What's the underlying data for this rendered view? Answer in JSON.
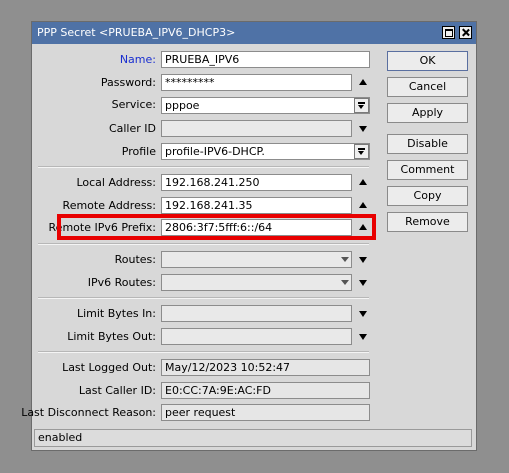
{
  "window": {
    "title": "PPP Secret <PRUEBA_IPV6_DHCP3>"
  },
  "fields": {
    "name": {
      "label": "Name:",
      "value": "PRUEBA_IPV6"
    },
    "password": {
      "label": "Password:",
      "value": "*********"
    },
    "service": {
      "label": "Service:",
      "value": "pppoe"
    },
    "caller_id": {
      "label": "Caller ID",
      "value": ""
    },
    "profile": {
      "label": "Profile",
      "value": "profile-IPV6-DHCP."
    },
    "local_address": {
      "label": "Local Address:",
      "value": "192.168.241.250"
    },
    "remote_address": {
      "label": "Remote Address:",
      "value": "192.168.241.35"
    },
    "remote_ipv6_prefix": {
      "label": "Remote IPv6 Prefix:",
      "value": "2806:3f7:5fff:6::/64"
    },
    "routes": {
      "label": "Routes:",
      "value": ""
    },
    "ipv6_routes": {
      "label": "IPv6 Routes:",
      "value": ""
    },
    "limit_bytes_in": {
      "label": "Limit Bytes In:",
      "value": ""
    },
    "limit_bytes_out": {
      "label": "Limit Bytes Out:",
      "value": ""
    },
    "last_logged_out": {
      "label": "Last Logged Out:",
      "value": "May/12/2023 10:52:47"
    },
    "last_caller_id": {
      "label": "Last Caller ID:",
      "value": "E0:CC:7A:9E:AC:FD"
    },
    "last_disconnect_reason": {
      "label": "Last Disconnect Reason:",
      "value": "peer request"
    }
  },
  "buttons": {
    "ok": "OK",
    "cancel": "Cancel",
    "apply": "Apply",
    "disable": "Disable",
    "comment": "Comment",
    "copy": "Copy",
    "remove": "Remove"
  },
  "status": {
    "text": "enabled"
  },
  "colors": {
    "titlebar": "#4f72a6",
    "highlight": "#e80000",
    "name_label": "#1a2fd0"
  },
  "icons": [
    "maximize-icon",
    "close-icon",
    "arrow-up-icon",
    "arrow-down-icon",
    "dropdown-icon"
  ]
}
